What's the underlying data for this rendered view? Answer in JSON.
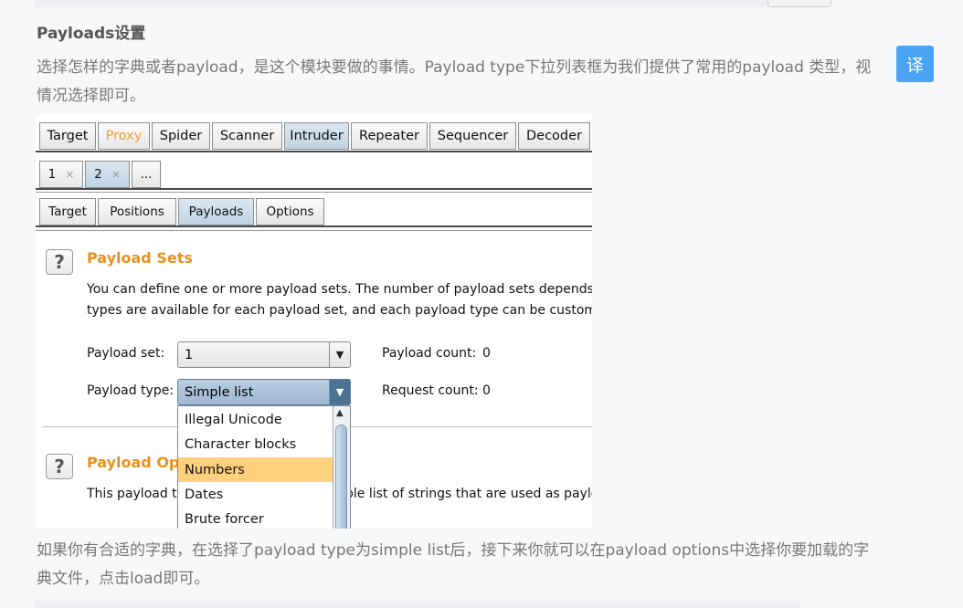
{
  "article": {
    "heading": "Payloads设置",
    "paragraph1": "选择怎样的字典或者payload，是这个模块要做的事情。Payload type下拉列表框为我们提供了常用的payload 类型，视情况选择即可。",
    "paragraph2": "如果你有合适的字典，在选择了payload type为simple list后，接下来你就可以在payload options中选择你要加载的字典文件，点击load即可。",
    "translate_label": "译"
  },
  "burp": {
    "main_tabs": [
      "Target",
      "Proxy",
      "Spider",
      "Scanner",
      "Intruder",
      "Repeater",
      "Sequencer",
      "Decoder"
    ],
    "active_main_tab": "Intruder",
    "highlight_tab": "Proxy",
    "attack_tabs": [
      "1",
      "2",
      "..."
    ],
    "attack_tab_close": "×",
    "sub_tabs": [
      "Target",
      "Positions",
      "Payloads",
      "Options"
    ],
    "active_sub_tab": "Payloads",
    "payload_sets": {
      "title": "Payload Sets",
      "desc_line1": "You can define one or more payload sets. The number of payload sets depends o",
      "desc_line2": "types are available for each payload set, and each payload type can be customize",
      "set_label": "Payload set:",
      "set_value": "1",
      "count_label": "Payload count:",
      "count_value": "0",
      "type_label": "Payload type:",
      "type_value": "Simple list",
      "request_label": "Request count:",
      "request_value": "0"
    },
    "payload_options": {
      "title_visible": "Payload Opt",
      "desc_left": "This payload ty",
      "desc_right": "ple list of strings that are used as paylo"
    },
    "dropdown_options": [
      "Illegal Unicode",
      "Character blocks",
      "Numbers",
      "Dates",
      "Brute forcer"
    ],
    "dropdown_selected": "Numbers",
    "help_icon": "?",
    "arrow_down": "▼",
    "arrow_up": "▲"
  },
  "colors": {
    "accent_orange": "#e8901c",
    "translate_blue": "#4aa3f5",
    "selection": "#fecf7d"
  }
}
